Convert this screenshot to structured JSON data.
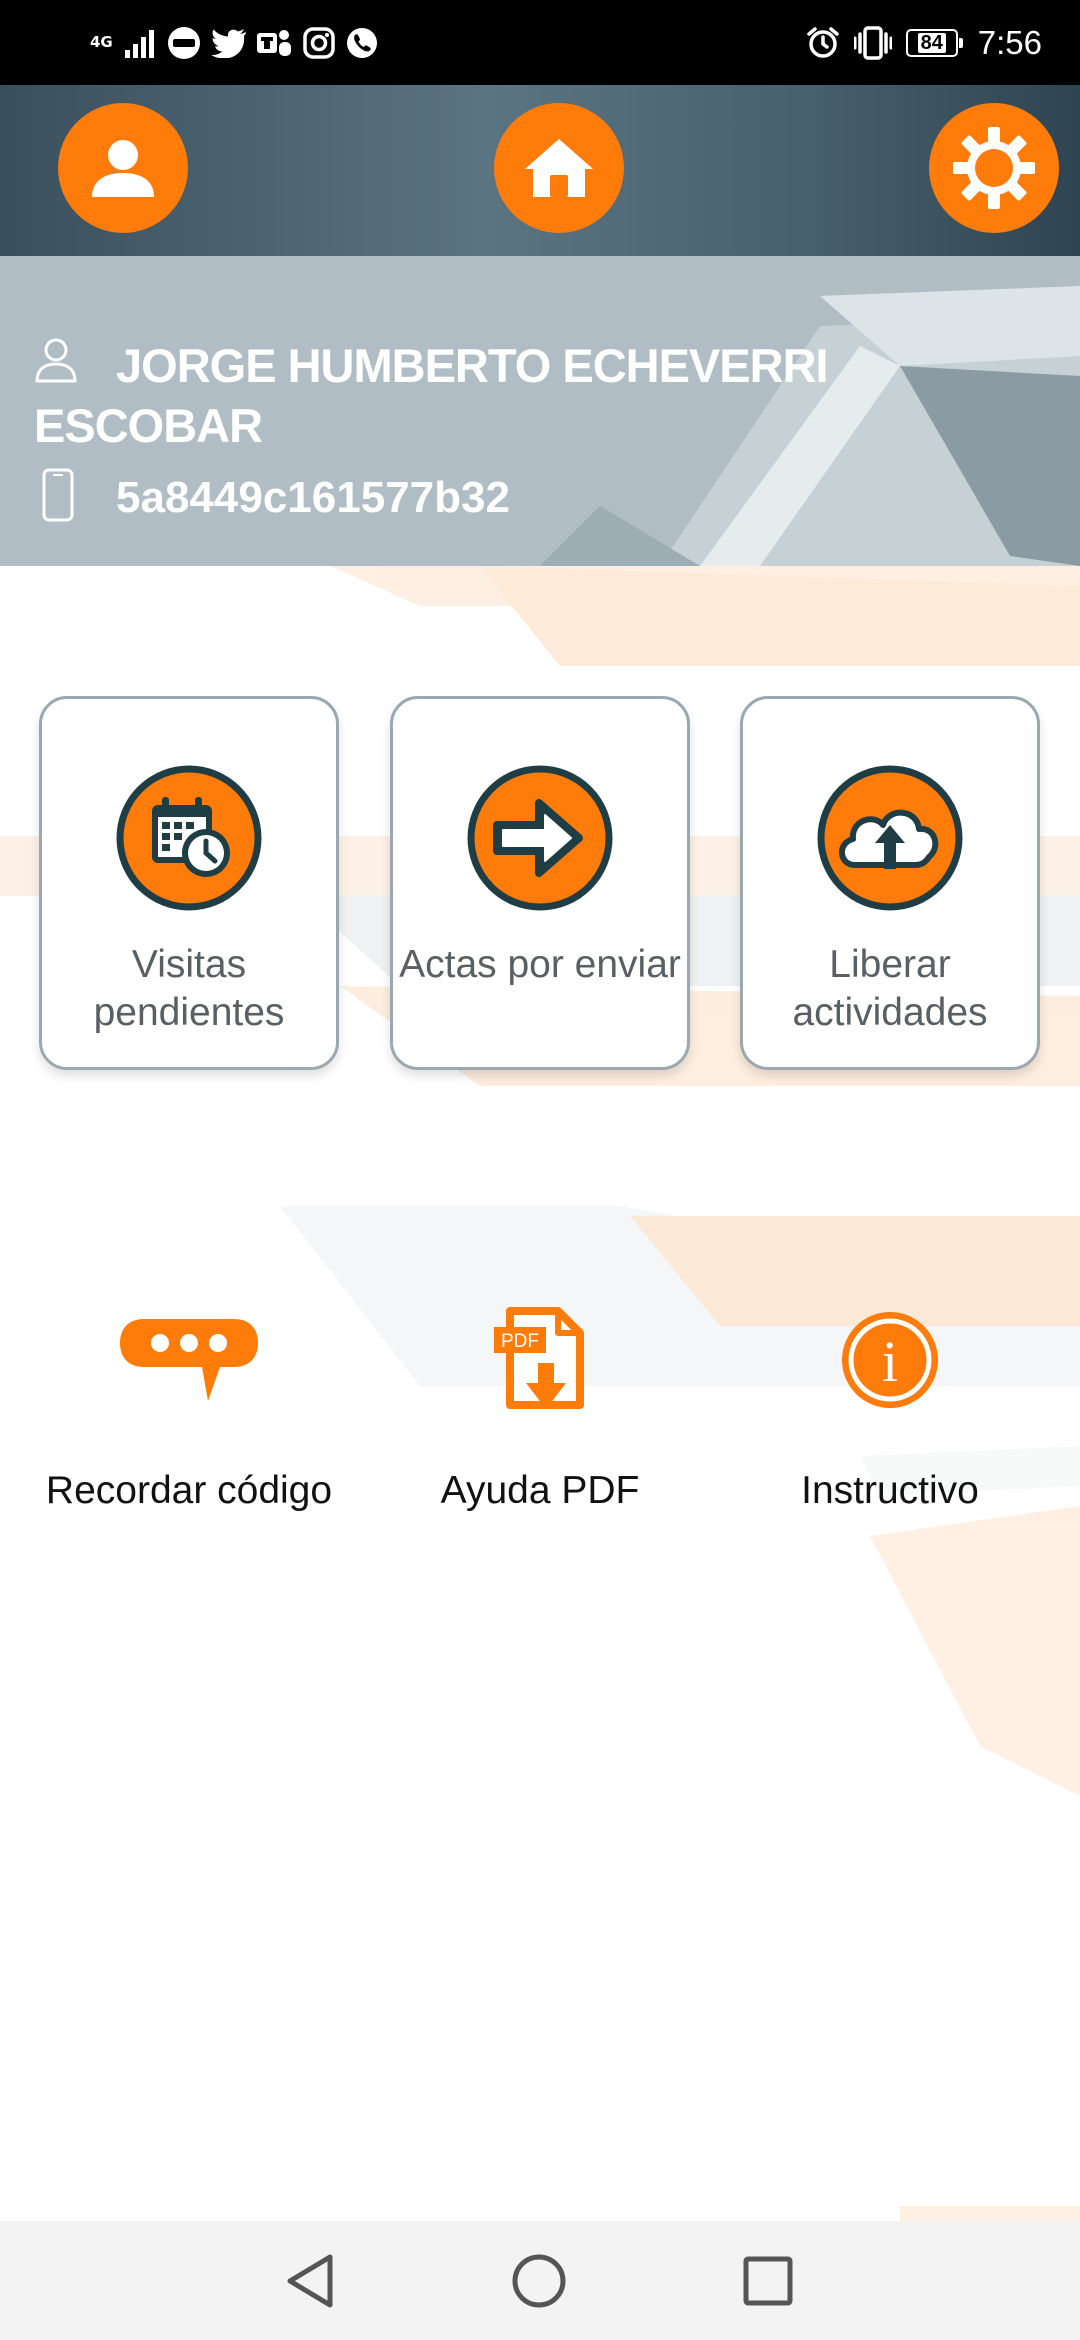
{
  "status_bar": {
    "network": "4G",
    "notification_icons": [
      "office-365-icon",
      "twitter-icon",
      "teams-icon",
      "instagram-icon",
      "whatsapp-icon"
    ],
    "battery": "84",
    "time": "7:56"
  },
  "top_nav": {
    "buttons": [
      "profile-icon",
      "home-icon",
      "gear-icon"
    ]
  },
  "user": {
    "name": "JORGE HUMBERTO ECHEVERRI ESCOBAR",
    "device_code": "5a8449c161577b32"
  },
  "cards": [
    {
      "label": "Visitas pendientes",
      "icon": "calendar-clock-icon"
    },
    {
      "label": "Actas por enviar",
      "icon": "arrow-right-icon"
    },
    {
      "label": "Liberar actividades",
      "icon": "cloud-upload-icon"
    }
  ],
  "actions": [
    {
      "label": "Recordar código",
      "icon": "chat-bubble-icon"
    },
    {
      "label": "Ayuda PDF",
      "icon": "pdf-icon",
      "icon_text": "PDF"
    },
    {
      "label": "Instructivo",
      "icon": "info-icon",
      "icon_text": "i"
    }
  ],
  "colors": {
    "accent": "#ff7b0a",
    "icon_dark": "#1e3d45",
    "nav_bar": "#4a6270",
    "user_panel": "#b1bdc4",
    "card_border": "#9aa8b1"
  }
}
